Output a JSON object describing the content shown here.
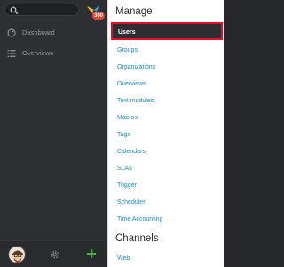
{
  "sidebar": {
    "search_placeholder": "",
    "badge_count": "300",
    "items": [
      {
        "label": "Dashboard",
        "icon": "dashboard-icon"
      },
      {
        "label": "Overviews",
        "icon": "list-icon"
      }
    ]
  },
  "manage": {
    "title": "Manage",
    "items": [
      "Users",
      "Groups",
      "Organizations",
      "Overviews",
      "Text modules",
      "Macros",
      "Tags",
      "Calendars",
      "SLAs",
      "Trigger",
      "Scheduler",
      "Time Accounting"
    ]
  },
  "channels": {
    "title": "Channels",
    "items": [
      "Web"
    ]
  },
  "colors": {
    "accent_link": "#1e88c8",
    "selected_bg": "#2d2e32",
    "highlight_border": "#e0102a",
    "add_button": "#4caf50",
    "badge": "#e0432d"
  }
}
